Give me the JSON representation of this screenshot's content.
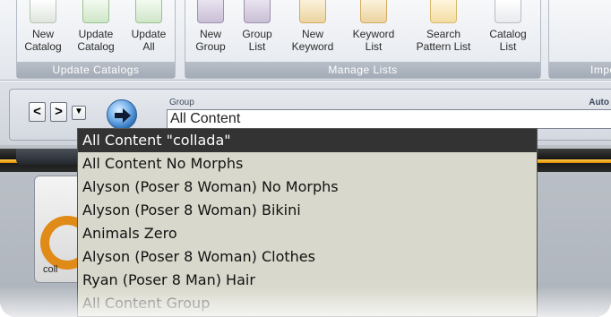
{
  "ribbon": {
    "update_catalogs": {
      "label": "Update Catalogs",
      "buttons": [
        {
          "line1": "New",
          "line2": "Catalog",
          "icon": "new-catalog-icon"
        },
        {
          "line1": "Update",
          "line2": "Catalog",
          "icon": "update-catalog-icon"
        },
        {
          "line1": "Update",
          "line2": "All",
          "icon": "update-all-icon"
        }
      ]
    },
    "manage_lists": {
      "label": "Manage Lists",
      "buttons": [
        {
          "line1": "New",
          "line2": "Group",
          "icon": "new-group-icon"
        },
        {
          "line1": "Group",
          "line2": "List",
          "icon": "group-list-icon"
        },
        {
          "line1": "New",
          "line2": "Keyword",
          "icon": "new-keyword-icon"
        },
        {
          "line1": "Keyword",
          "line2": "List",
          "icon": "keyword-list-icon"
        },
        {
          "line1": "Search",
          "line2": "Pattern List",
          "icon": "search-pattern-icon"
        },
        {
          "line1": "Catalog",
          "line2": "List",
          "icon": "catalog-list-icon"
        }
      ]
    },
    "partial_group_label": "Impo"
  },
  "nav": {
    "back_label": "<",
    "forward_label": ">",
    "group_caption": "Group",
    "group_value": "All Content",
    "auto_caption": "Auto"
  },
  "thumbnail": {
    "label": "coll"
  },
  "dropdown": {
    "items": [
      "All Content \"collada\"",
      "All Content No Morphs",
      "Alyson (Poser 8 Woman) No Morphs",
      "Alyson (Poser 8 Woman) Bikini",
      "Animals Zero",
      "Alyson (Poser 8 Woman) Clothes",
      "Ryan (Poser 8 Man) Hair",
      "All Content Group"
    ],
    "selected_index": 0
  },
  "colors": {
    "accent_orange": "#e28a00",
    "selected_bg": "#333333",
    "list_bg": "#d9d8cc"
  }
}
